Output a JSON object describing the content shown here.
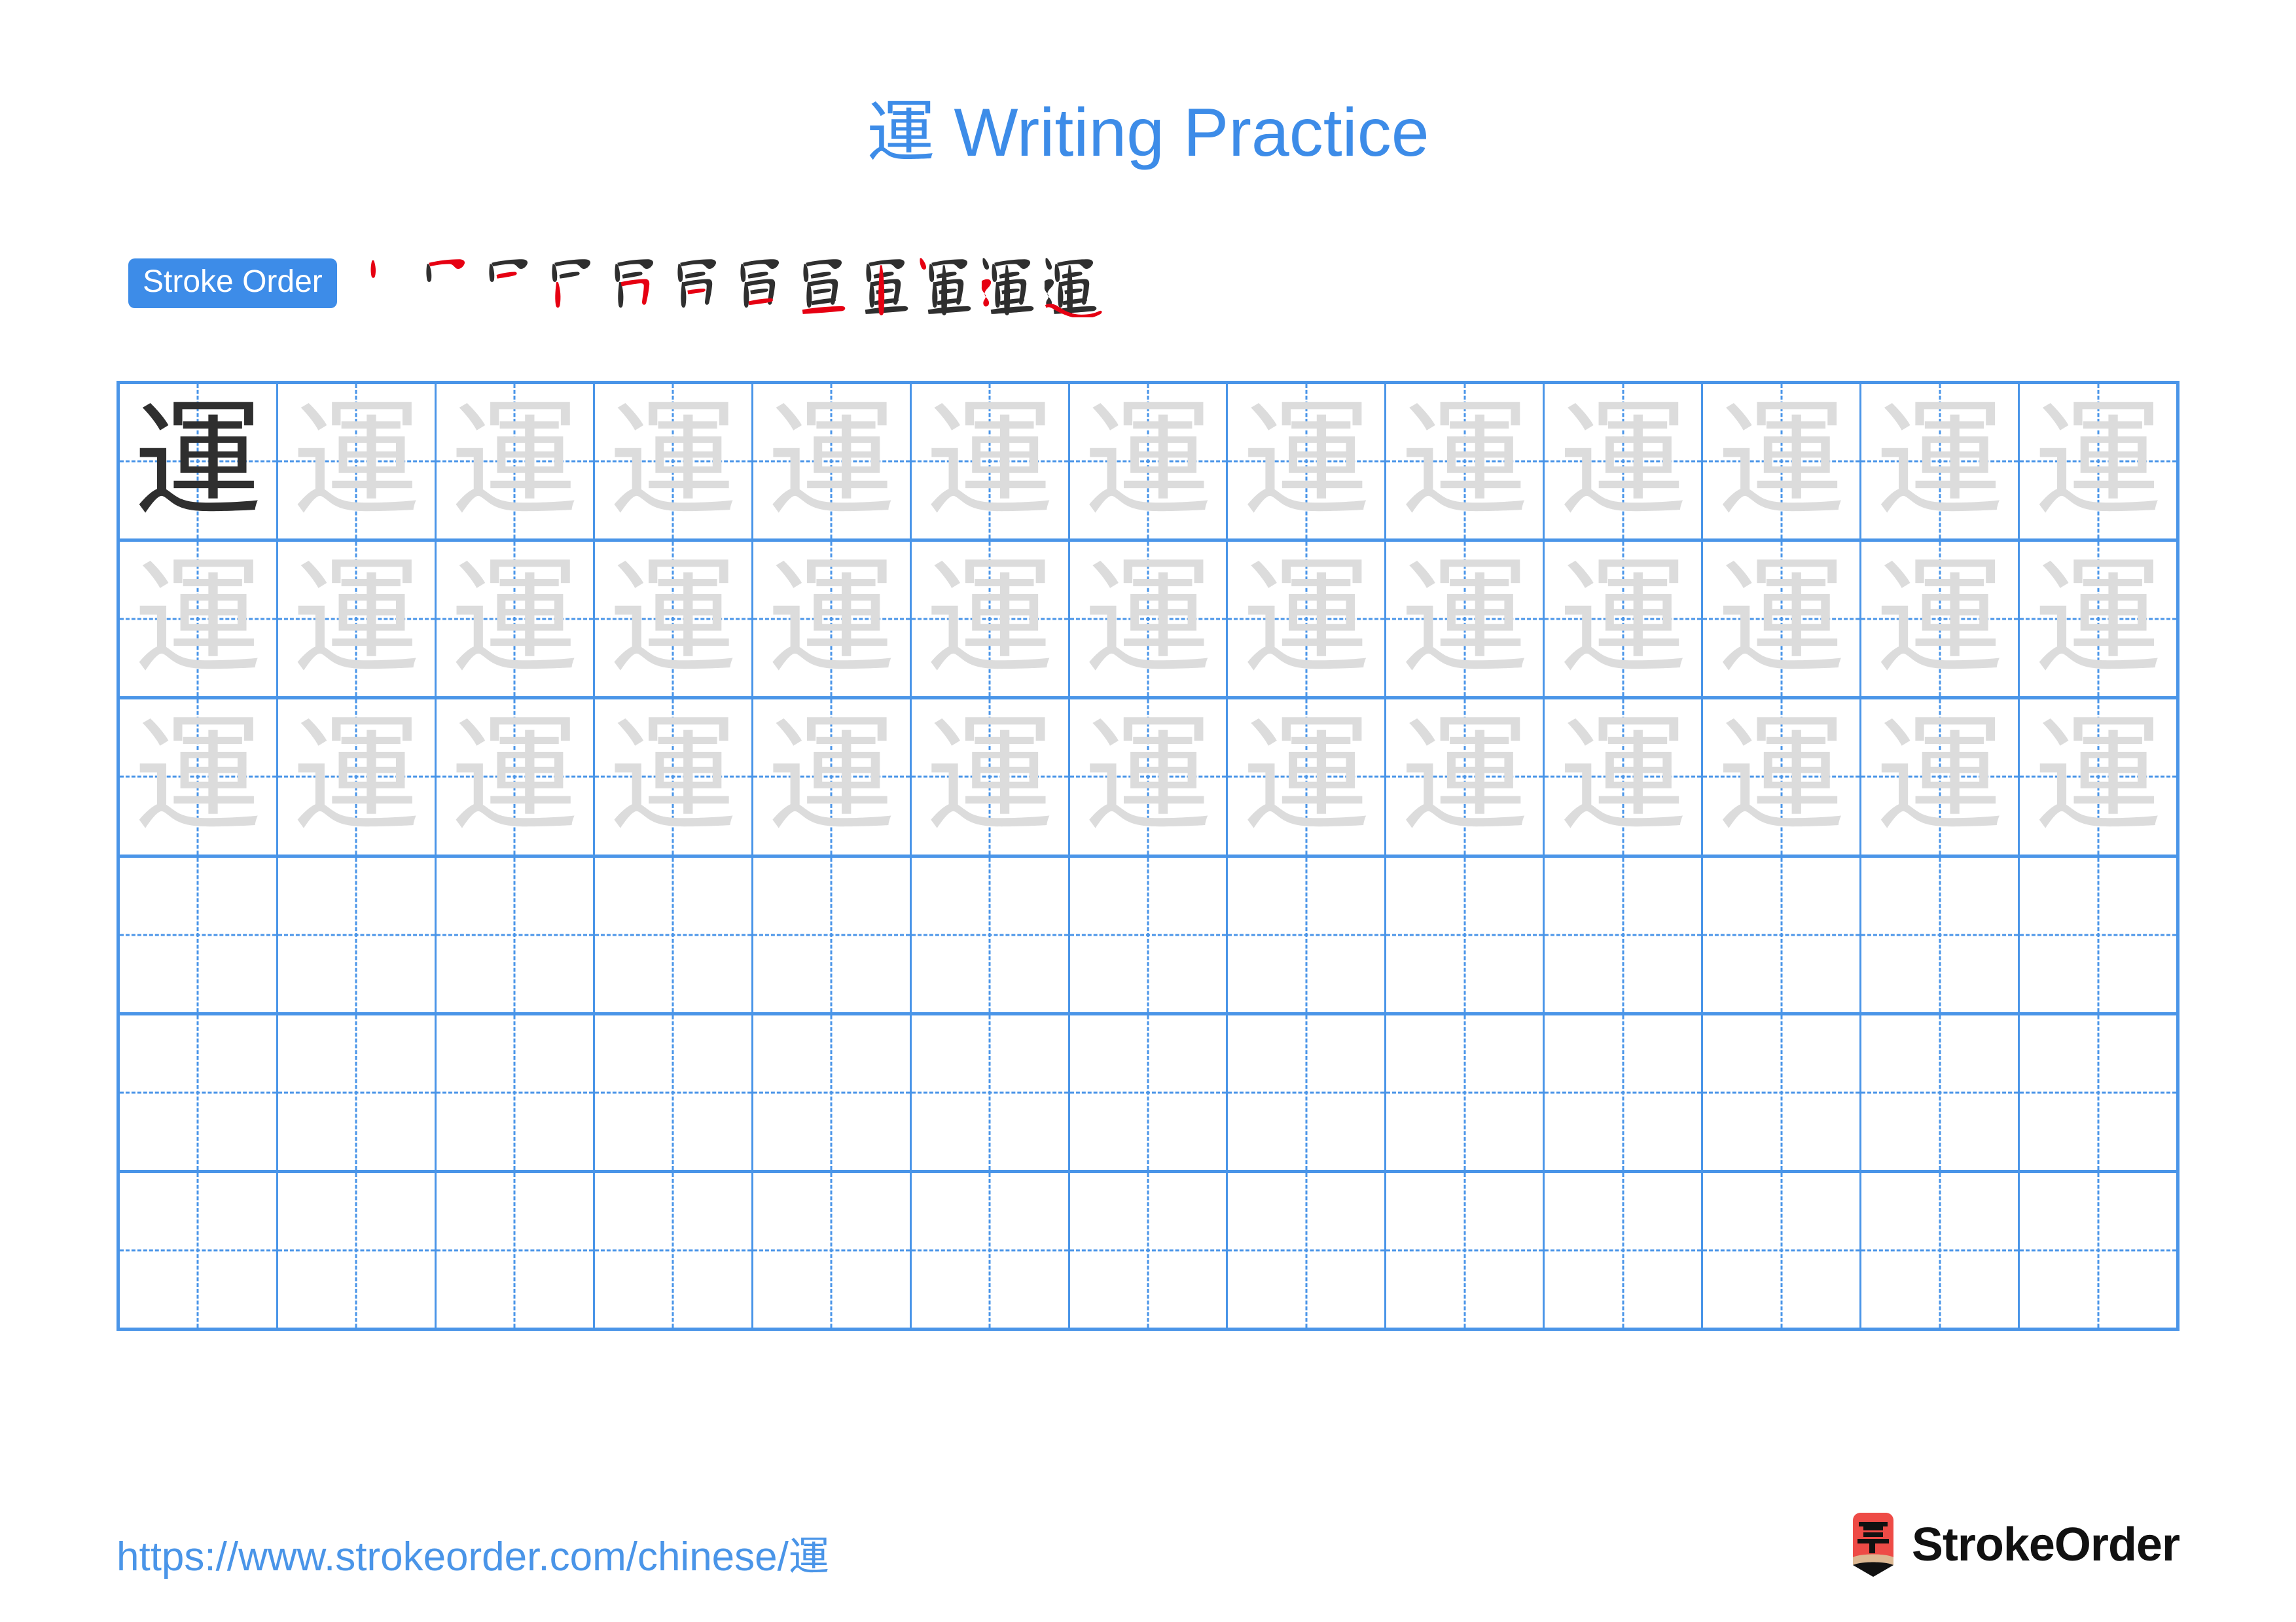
{
  "page": {
    "character": "運",
    "title_suffix": " Writing Practice",
    "title_full": "運 Writing Practice",
    "background_color": "#ffffff",
    "accent_color": "#3d8ce8",
    "grid_line_color": "#4a95e8",
    "new_stroke_color": "#e60012",
    "existing_stroke_color": "#2f2f2f",
    "trace_char_color": "#dcdcdc",
    "model_char_color": "#2f2f2f"
  },
  "stroke_order": {
    "badge_label": "Stroke Order",
    "total_strokes": 12,
    "steps": [
      {
        "index": 1,
        "label": "stroke-step-1"
      },
      {
        "index": 2,
        "label": "stroke-step-2"
      },
      {
        "index": 3,
        "label": "stroke-step-3"
      },
      {
        "index": 4,
        "label": "stroke-step-4"
      },
      {
        "index": 5,
        "label": "stroke-step-5"
      },
      {
        "index": 6,
        "label": "stroke-step-6"
      },
      {
        "index": 7,
        "label": "stroke-step-7"
      },
      {
        "index": 8,
        "label": "stroke-step-8"
      },
      {
        "index": 9,
        "label": "stroke-step-9"
      },
      {
        "index": 10,
        "label": "stroke-step-10"
      },
      {
        "index": 11,
        "label": "stroke-step-11"
      },
      {
        "index": 12,
        "label": "stroke-step-12"
      }
    ]
  },
  "practice_grid": {
    "columns": 13,
    "rows": 6,
    "guide_style": "dashed-crosshair",
    "row_contents": [
      {
        "row": 1,
        "type": "traced",
        "model_cell": 1,
        "char": "運",
        "filled_cells": 13
      },
      {
        "row": 2,
        "type": "traced",
        "model_cell": 0,
        "char": "運",
        "filled_cells": 13
      },
      {
        "row": 3,
        "type": "traced",
        "model_cell": 0,
        "char": "運",
        "filled_cells": 13
      },
      {
        "row": 4,
        "type": "blank",
        "model_cell": 0,
        "char": "",
        "filled_cells": 0
      },
      {
        "row": 5,
        "type": "blank",
        "model_cell": 0,
        "char": "",
        "filled_cells": 0
      },
      {
        "row": 6,
        "type": "blank",
        "model_cell": 0,
        "char": "",
        "filled_cells": 0
      }
    ]
  },
  "footer": {
    "url_prefix": "https://www.strokeorder.com/chinese/",
    "url_character": "運",
    "url_full": "https://www.strokeorder.com/chinese/運",
    "brand_name": "StrokeOrder",
    "logo_glyph": "字",
    "logo_body_color": "#ee4b46",
    "logo_wood_color": "#ddb892",
    "logo_tip_color": "#111111"
  }
}
